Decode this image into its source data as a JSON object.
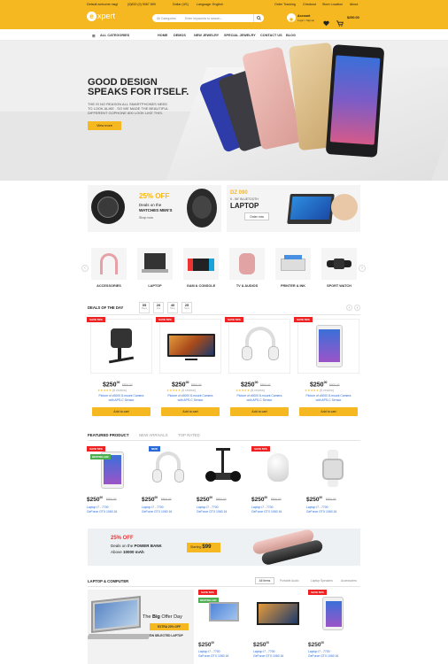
{
  "topbar": {
    "welcome": "Default welcome msg!",
    "phone": "(0)833 (0) 9067 899",
    "currency": "Dollar (US)",
    "language": "Language: English",
    "order_tracking": "Order Tracking",
    "checkout": "Checkout",
    "store_location": "Store Location",
    "about": "About"
  },
  "header": {
    "logo_badge": "e",
    "logo_text": "xpert",
    "search_category": "All Categories",
    "search_placeholder": "Enter keywords to search...",
    "account_label": "Account",
    "account_sub": "Login / Signup",
    "cart_total": "$250.00"
  },
  "nav": {
    "all_categories": "ALL CATEGORIES",
    "items": [
      "HOME",
      "DEMOS",
      "NEW JEWELRY",
      "SPECIAL JEWELRY",
      "CONTACT US",
      "BLOG"
    ]
  },
  "hero": {
    "title_line1": "GOOD DESIGN",
    "title_line2": "SPEAKS FOR ITSELF.",
    "body_line1": "THE IS NO REASON ALL SMARTPHONES NEED",
    "body_line2": "TO LOOK ALIKE . SO WE MADE THE BEAUTIFUL",
    "body_line3": "DIFFERENT GOPHONE 800 LOOK LIKE THIS.",
    "button": "View more"
  },
  "banner_watch": {
    "headline": "25% OFF",
    "line1": "Deals on the",
    "line2": "WATCHES MEN'S",
    "cta": "Shop now"
  },
  "banner_laptop": {
    "price": "DZ 090",
    "sub": "K - 56\" BLUETOOTH",
    "title": "LAPTOP",
    "button": "Order now"
  },
  "categories": [
    "ACCESSORIES",
    "LAPTOP",
    "GAM & CONSOLE",
    "TV & AUDIOS",
    "PRINTER & INK",
    "SPORT WATCH"
  ],
  "deals": {
    "title": "DEALS OF THE DAY",
    "timer": [
      {
        "value": "05",
        "unit": "Days"
      },
      {
        "value": "20",
        "unit": "Hrs"
      },
      {
        "value": "40",
        "unit": "Mins"
      },
      {
        "value": "25",
        "unit": "Secs"
      }
    ],
    "sale_badge": "SAVE 50%",
    "price": "$250",
    "cents": "00",
    "old_price": "$500.00",
    "stars": "★★★★★",
    "reviews": "(6 review)",
    "desc_line1": "Picture of z5000 8-mount Camera",
    "desc_line2": "with APS-C Sensor",
    "button": "Add to cart"
  },
  "featured": {
    "tabs": [
      "FEATURED PRODUCT",
      "NEW ARRIVALS",
      "TOP RATED"
    ],
    "price": "$250",
    "cents": "00",
    "old_price": "$500.00",
    "desc_line1": "Laptop i7 - 7700",
    "desc_line2": "GeForce GTX 1060 16",
    "badge_sale": "SAVE 50%",
    "badge_best": "BESTSELLER",
    "badge_new": "NEW"
  },
  "powerbank": {
    "headline": "25% OFF",
    "line1": "Deals on the",
    "bold": "POWER BANK",
    "line2": "Above",
    "capacity": "10000 mAh",
    "starting": "Starting",
    "price": "$99"
  },
  "laptop_section": {
    "title": "LAPTOP & COMPUTER",
    "tabs": [
      "All Items",
      "Portable Audio",
      "Laptop Speakers",
      "Accessories"
    ],
    "promo_title_a": "The",
    "promo_title_b": "Big",
    "promo_title_c": "Offer Day",
    "promo_badge": "EXTRA 20% OFF",
    "promo_sub": "ON SELECTED LAPTOP",
    "price": "$250",
    "cents": "00",
    "desc_line1": "Laptop i7 - 7700",
    "desc_line2": "GeForce GTX 1060 16"
  },
  "colors": {
    "accent": "#f6b820",
    "sale": "#ee2222",
    "link": "#2a6ad8"
  }
}
